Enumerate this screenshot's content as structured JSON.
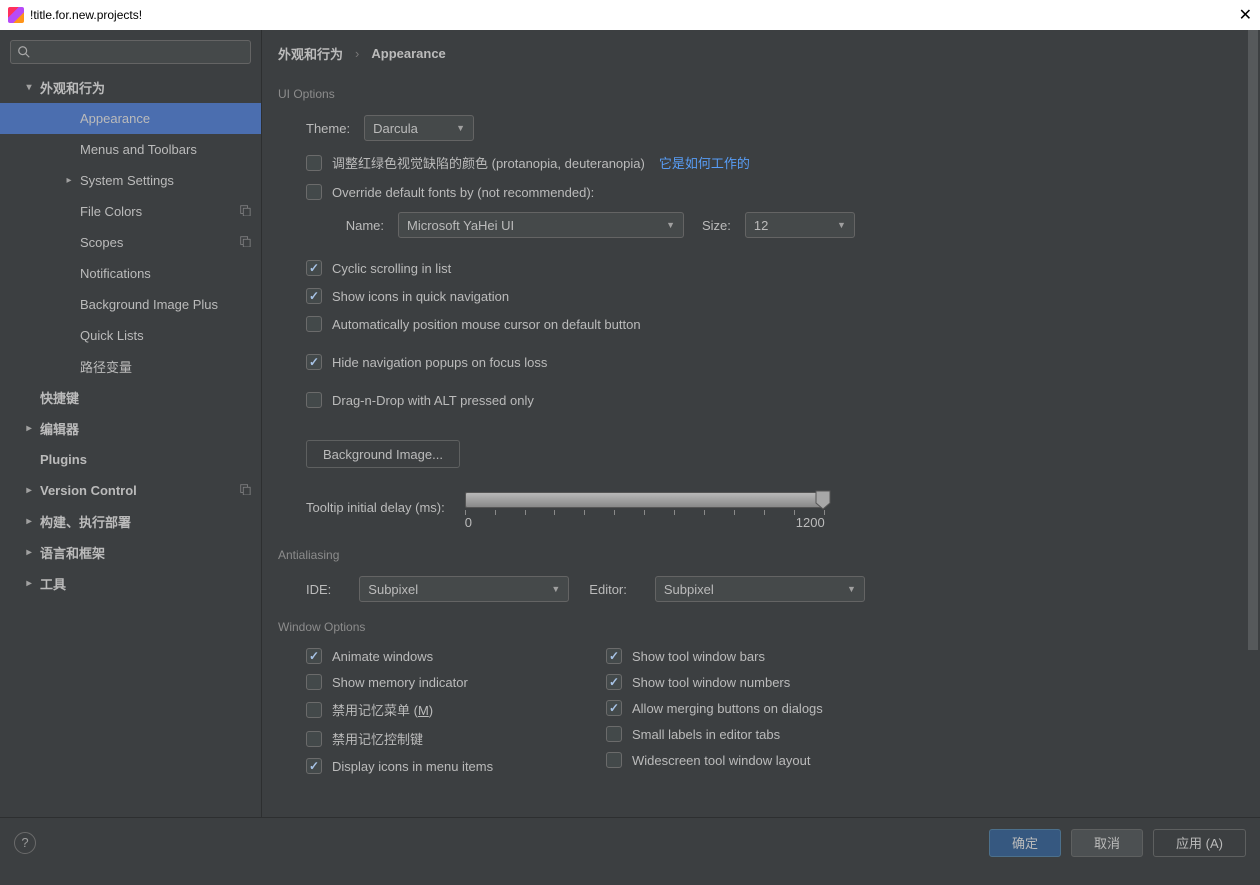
{
  "titlebar": {
    "title": "!title.for.new.projects!"
  },
  "sidebar": {
    "items": [
      {
        "label": "外观和行为",
        "depth": 0,
        "expanded": true,
        "bold": true,
        "chev": "down"
      },
      {
        "label": "Appearance",
        "depth": 1,
        "selected": true
      },
      {
        "label": "Menus and Toolbars",
        "depth": 1
      },
      {
        "label": "System Settings",
        "depth": 1,
        "chev": "right"
      },
      {
        "label": "File Colors",
        "depth": 1,
        "copy": true
      },
      {
        "label": "Scopes",
        "depth": 1,
        "copy": true
      },
      {
        "label": "Notifications",
        "depth": 1
      },
      {
        "label": "Background Image Plus",
        "depth": 1
      },
      {
        "label": "Quick Lists",
        "depth": 1
      },
      {
        "label": "路径变量",
        "depth": 1
      },
      {
        "label": "快捷键",
        "depth": 0,
        "bold": true
      },
      {
        "label": "编辑器",
        "depth": 0,
        "chev": "right",
        "bold": true
      },
      {
        "label": "Plugins",
        "depth": 0,
        "bold": true
      },
      {
        "label": "Version Control",
        "depth": 0,
        "chev": "right",
        "bold": true,
        "copy": true
      },
      {
        "label": "构建、执行部署",
        "depth": 0,
        "chev": "right",
        "bold": true
      },
      {
        "label": "语言和框架",
        "depth": 0,
        "chev": "right",
        "bold": true
      },
      {
        "label": "工具",
        "depth": 0,
        "chev": "right",
        "bold": true
      }
    ]
  },
  "breadcrumb": {
    "root": "外观和行为",
    "sep": "›",
    "leaf": "Appearance"
  },
  "ui_options": {
    "title": "UI Options",
    "theme_label": "Theme:",
    "theme_value": "Darcula",
    "color_deficiency": {
      "checked": false,
      "label": "调整红绿色视觉缺陷的颜色 (protanopia, deuteranopia)",
      "link": "它是如何工作的"
    },
    "override_fonts": {
      "checked": false,
      "label": "Override default fonts by (not recommended):"
    },
    "font_name_label": "Name:",
    "font_name_value": "Microsoft YaHei UI",
    "font_size_label": "Size:",
    "font_size_value": "12",
    "cyclic": {
      "checked": true,
      "label": "Cyclic scrolling in list"
    },
    "show_icons": {
      "checked": true,
      "label": "Show icons in quick navigation"
    },
    "auto_cursor": {
      "checked": false,
      "label": "Automatically position mouse cursor on default button"
    },
    "hide_popups": {
      "checked": true,
      "label": "Hide navigation popups on focus loss"
    },
    "dnd_alt": {
      "checked": false,
      "label": "Drag-n-Drop with ALT pressed only"
    },
    "bg_image_btn": "Background Image...",
    "tooltip_label": "Tooltip initial delay (ms):",
    "tooltip_min": "0",
    "tooltip_max": "1200"
  },
  "antialiasing": {
    "title": "Antialiasing",
    "ide_label": "IDE:",
    "ide_value": "Subpixel",
    "editor_label": "Editor:",
    "editor_value": "Subpixel"
  },
  "window_options": {
    "title": "Window Options",
    "left": [
      {
        "checked": true,
        "label": "Animate windows"
      },
      {
        "checked": false,
        "label": "Show memory indicator"
      },
      {
        "checked": false,
        "label_pre": "禁用记忆菜单 (",
        "u": "M",
        "label_post": ")"
      },
      {
        "checked": false,
        "label": "禁用记忆控制键"
      },
      {
        "checked": true,
        "label": "Display icons in menu items"
      }
    ],
    "right": [
      {
        "checked": true,
        "label": "Show tool window bars"
      },
      {
        "checked": true,
        "label": "Show tool window numbers"
      },
      {
        "checked": true,
        "label": "Allow merging buttons on dialogs"
      },
      {
        "checked": false,
        "label": "Small labels in editor tabs"
      },
      {
        "checked": false,
        "label": "Widescreen tool window layout"
      }
    ]
  },
  "footer": {
    "ok": "确定",
    "cancel": "取消",
    "apply": "应用 (A)"
  }
}
